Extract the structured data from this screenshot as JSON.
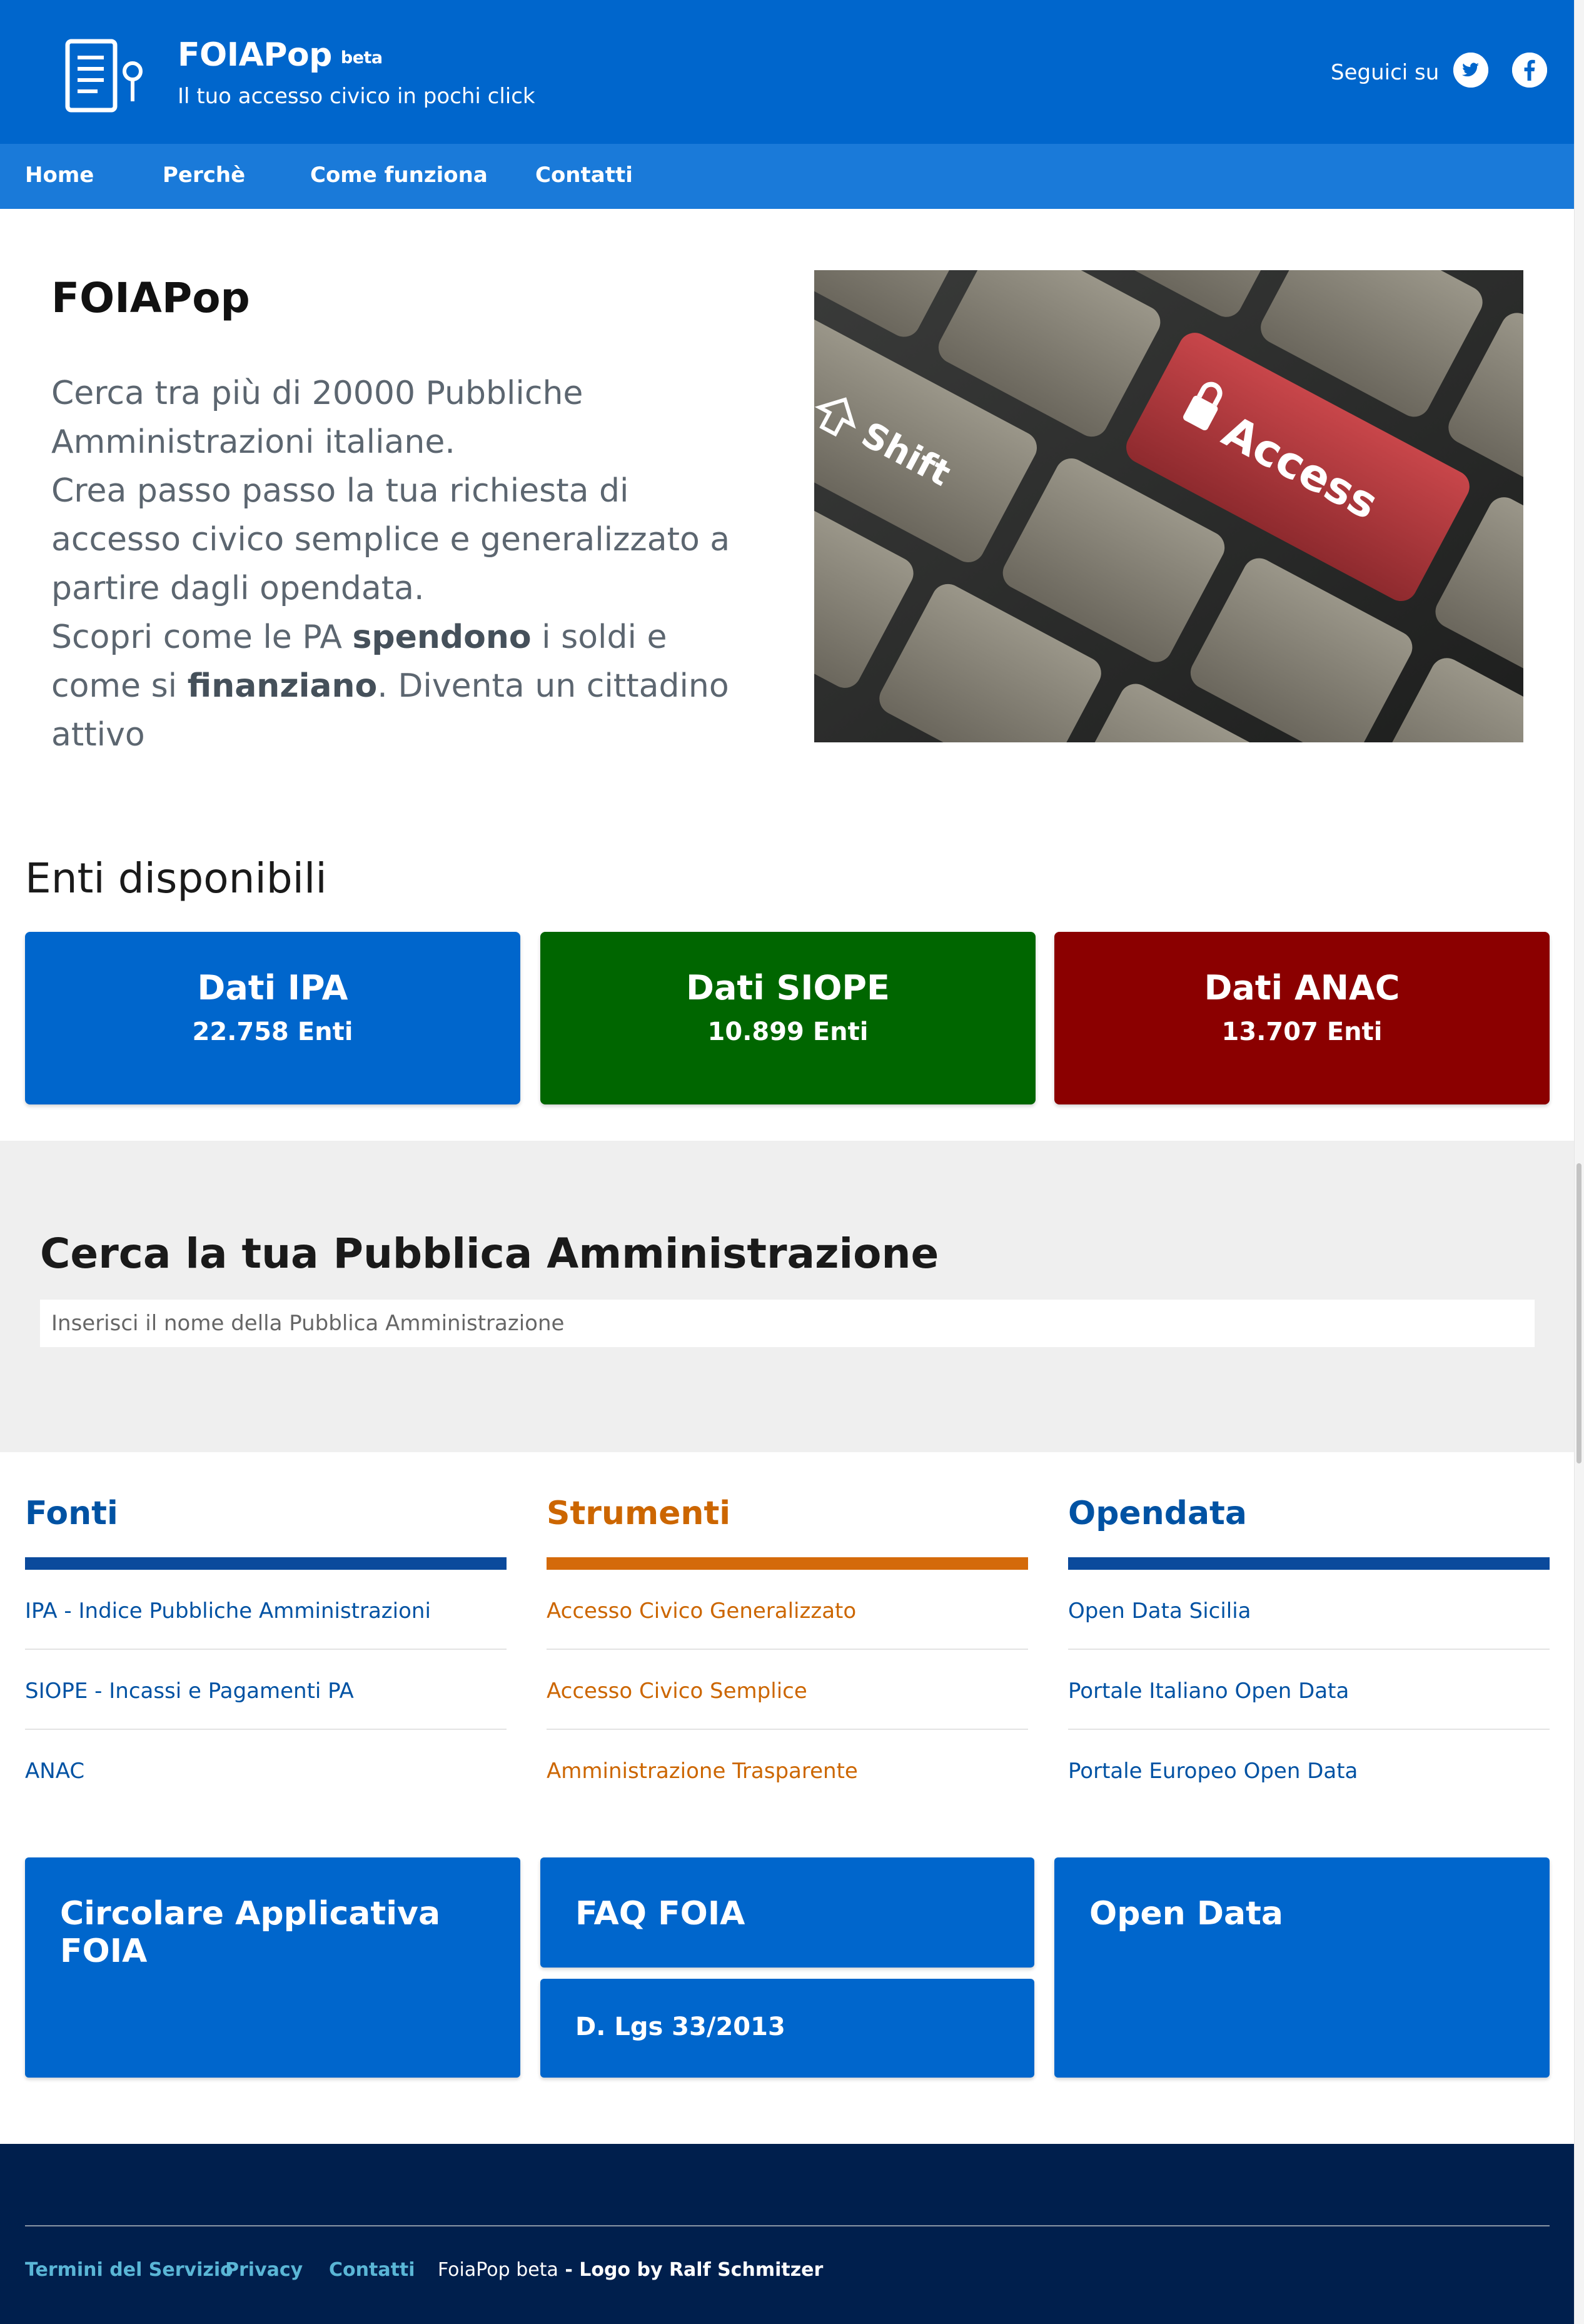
{
  "brand": {
    "title": "FOIAPop",
    "badge": "beta",
    "tagline": "Il tuo accesso civico in pochi click"
  },
  "social": {
    "label": "Seguici su",
    "icons": [
      "twitter-icon",
      "facebook-icon"
    ]
  },
  "nav": {
    "items": [
      "Home",
      "Perchè",
      "Come funziona",
      "Contatti"
    ]
  },
  "hero": {
    "title": "FOIAPop",
    "line1": "Cerca tra più di 20000 Pubbliche Amministrazioni italiane.",
    "line2": "Crea passo passo la tua richiesta di accesso civico semplice e generalizzato a partire dagli opendata.",
    "line3_a": "Scopri come le PA ",
    "line3_b": "spendono",
    "line3_c": " i soldi e come si ",
    "line3_d": "finanziano",
    "line3_e": ". Diventa un cittadino attivo",
    "image": {
      "key_access": "Access",
      "key_shift": "Shift"
    }
  },
  "enti": {
    "title": "Enti disponibili",
    "cards": [
      {
        "name": "Dati IPA",
        "count": "22.758 Enti",
        "color": "#0066cc"
      },
      {
        "name": "Dati SIOPE",
        "count": "10.899 Enti",
        "color": "#006600"
      },
      {
        "name": "Dati ANAC",
        "count": "13.707 Enti",
        "color": "#8b0000"
      }
    ]
  },
  "search": {
    "title": "Cerca la tua Pubblica Amministrazione",
    "placeholder": "Inserisci il nome della Pubblica Amministrazione"
  },
  "columns": [
    {
      "title": "Fonti",
      "color": "#0052a3",
      "bar_color": "#0b4a9c",
      "links": [
        "IPA - Indice Pubbliche Amministrazioni",
        "SIOPE - Incassi e Pagamenti PA",
        "ANAC"
      ]
    },
    {
      "title": "Strumenti",
      "color": "#cc6600",
      "bar_color": "#d46a0a",
      "links": [
        "Accesso Civico Generalizzato",
        "Accesso Civico Semplice",
        "Amministrazione Trasparente"
      ]
    },
    {
      "title": "Opendata",
      "color": "#0052a3",
      "bar_color": "#0b4a9c",
      "links": [
        "Open Data Sicilia",
        "Portale Italiano Open Data",
        "Portale Europeo Open Data"
      ]
    }
  ],
  "cards": {
    "circolare": "Circolare Applicativa FOIA",
    "faq": "FAQ FOIA",
    "dlgs": "D. Lgs 33/2013",
    "opendata": "Open Data"
  },
  "footer": {
    "links": [
      "Termini del Servizio",
      "Privacy",
      "Contatti"
    ],
    "credit_a": "FoiaPop beta",
    "credit_b": " - Logo by Ralf Schmitzer"
  }
}
